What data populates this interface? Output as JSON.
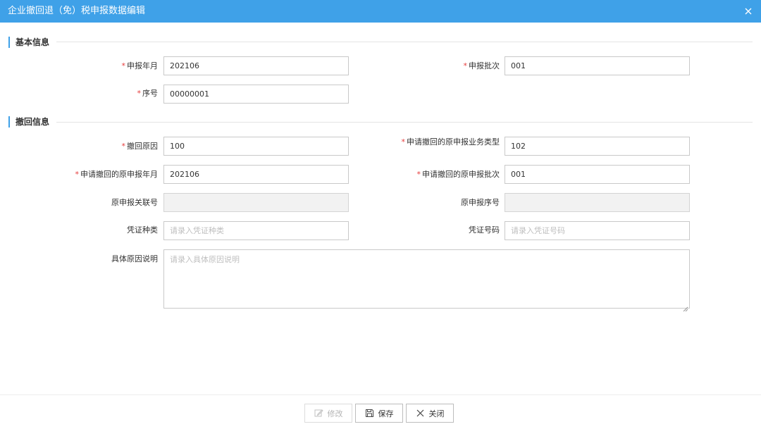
{
  "window": {
    "title": "企业撤回退（免）税申报数据编辑",
    "close_icon": "close-icon"
  },
  "sections": {
    "basic": "基本信息",
    "withdraw": "撤回信息"
  },
  "basic": {
    "month_label": "申报年月",
    "month_value": "202106",
    "batch_label": "申报批次",
    "batch_value": "001",
    "seq_label": "序号",
    "seq_value": "00000001"
  },
  "withdraw": {
    "reason_label": "撤回原因",
    "reason_value": "100",
    "biztype_label": "申请撤回的原申报业务类型",
    "biztype_value": "102",
    "orig_month_label": "申请撤回的原申报年月",
    "orig_month_value": "202106",
    "orig_batch_label": "申请撤回的原申报批次",
    "orig_batch_value": "001",
    "assoc_no_label": "原申报关联号",
    "assoc_no_value": "",
    "orig_seq_label": "原申报序号",
    "orig_seq_value": "",
    "voucher_type_label": "凭证种类",
    "voucher_type_placeholder": "请录入凭证种类",
    "voucher_no_label": "凭证号码",
    "voucher_no_placeholder": "请录入凭证号码",
    "detail_label": "具体原因说明",
    "detail_placeholder": "请录入具体原因说明"
  },
  "required_mark": "*",
  "footer": {
    "edit_label": "修改",
    "save_label": "保存",
    "close_label": "关闭"
  },
  "colors": {
    "accent": "#3fa1e8",
    "required": "#e63c3c"
  }
}
